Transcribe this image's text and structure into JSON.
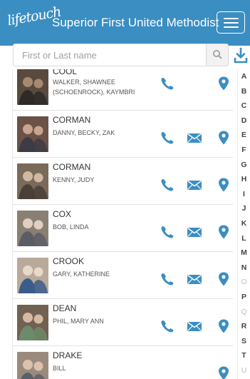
{
  "header": {
    "logo_text": "lifetouch",
    "title": "Superior First United Methodist"
  },
  "search": {
    "placeholder": "First or Last name"
  },
  "colors": {
    "brand": "#3a8ec2",
    "icon": "#3a8ec2"
  },
  "entries": [
    {
      "surname": "COOL",
      "members": "WALKER, SHAWNEE (SCHOENROCK), KAYMBRI",
      "has_email": false,
      "has_phone": true
    },
    {
      "surname": "CORMAN",
      "members": "DANNY, BECKY, ZAK",
      "has_email": true,
      "has_phone": true
    },
    {
      "surname": "CORMAN",
      "members": "KENNY, JUDY",
      "has_email": true,
      "has_phone": true
    },
    {
      "surname": "COX",
      "members": "BOB, LINDA",
      "has_email": true,
      "has_phone": true
    },
    {
      "surname": "CROOK",
      "members": "GARY, KATHERINE",
      "has_email": true,
      "has_phone": true
    },
    {
      "surname": "DEAN",
      "members": "PHIL, MARY ANN",
      "has_email": true,
      "has_phone": true
    },
    {
      "surname": "DRAKE",
      "members": "BILL",
      "has_email": false,
      "has_phone": false
    }
  ],
  "alphabet": [
    {
      "letter": "A",
      "active": true
    },
    {
      "letter": "B",
      "active": true
    },
    {
      "letter": "C",
      "active": true
    },
    {
      "letter": "D",
      "active": true
    },
    {
      "letter": "E",
      "active": true
    },
    {
      "letter": "F",
      "active": true
    },
    {
      "letter": "G",
      "active": true
    },
    {
      "letter": "H",
      "active": true
    },
    {
      "letter": "I",
      "active": true
    },
    {
      "letter": "J",
      "active": true
    },
    {
      "letter": "K",
      "active": true
    },
    {
      "letter": "L",
      "active": true
    },
    {
      "letter": "M",
      "active": true
    },
    {
      "letter": "N",
      "active": true
    },
    {
      "letter": "O",
      "active": false
    },
    {
      "letter": "P",
      "active": true
    },
    {
      "letter": "Q",
      "active": false
    },
    {
      "letter": "R",
      "active": true
    },
    {
      "letter": "S",
      "active": true
    },
    {
      "letter": "T",
      "active": true
    },
    {
      "letter": "U",
      "active": false
    }
  ]
}
